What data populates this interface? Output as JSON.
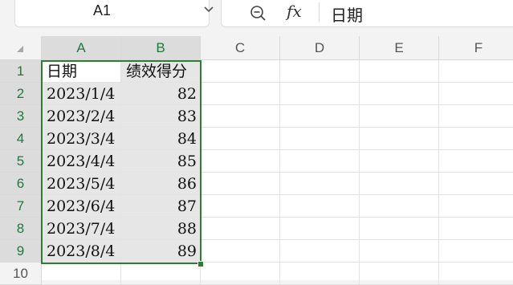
{
  "formula_bar": {
    "name_box": "A1",
    "zoom_icon": "zoom-out-icon",
    "fx_label": "fx",
    "content": "日期"
  },
  "columns": [
    "A",
    "B",
    "C",
    "D",
    "E",
    "F"
  ],
  "rows": [
    "1",
    "2",
    "3",
    "4",
    "5",
    "6",
    "7",
    "8",
    "9",
    "10"
  ],
  "table": {
    "header": [
      "日期",
      "绩效得分"
    ],
    "data": [
      [
        "2023/1/4",
        "82"
      ],
      [
        "2023/2/4",
        "83"
      ],
      [
        "2023/3/4",
        "84"
      ],
      [
        "2023/4/4",
        "85"
      ],
      [
        "2023/5/4",
        "86"
      ],
      [
        "2023/6/4",
        "87"
      ],
      [
        "2023/7/4",
        "88"
      ],
      [
        "2023/8/4",
        "89"
      ]
    ]
  },
  "colors": {
    "selection": "#2e7d32",
    "header_selected_text": "#1f7a3a",
    "selected_fill": "#e6e6e6"
  }
}
